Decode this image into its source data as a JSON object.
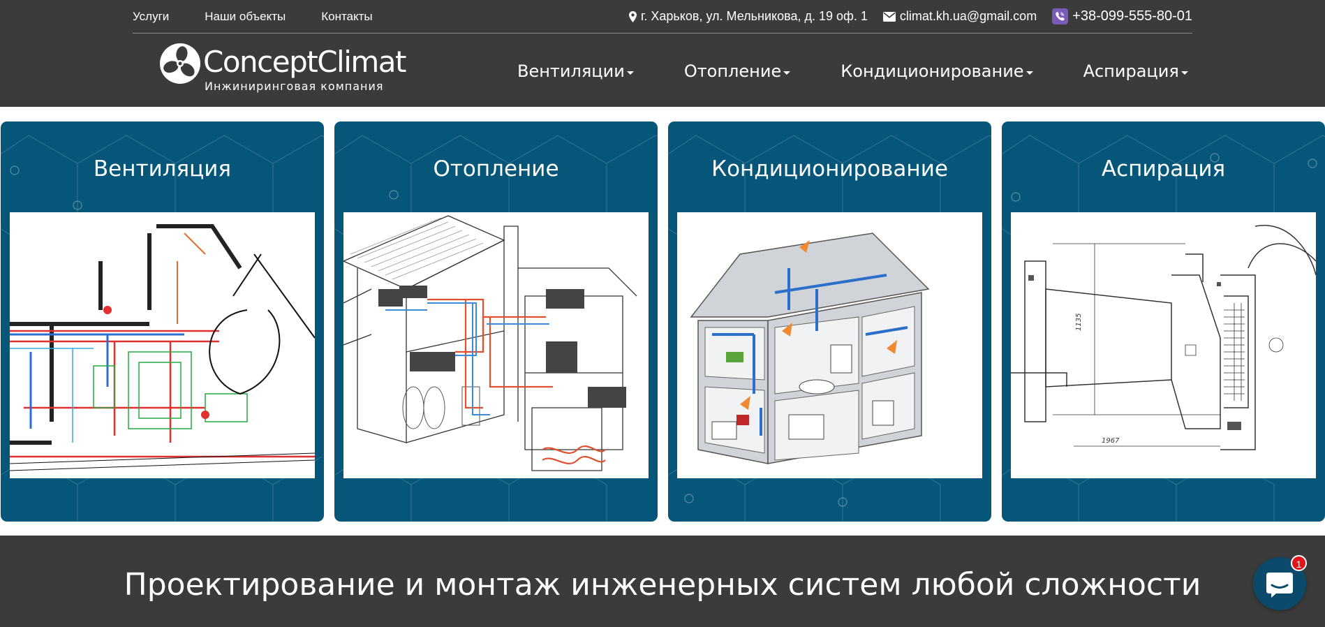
{
  "topbar": {
    "links": [
      "Услуги",
      "Наши объекты",
      "Контакты"
    ],
    "address": "г. Харьков, ул. Мельникова, д. 19 оф. 1",
    "email": "climat.kh.ua@gmail.com",
    "phone": "+38-099-555-80-01"
  },
  "logo": {
    "name": "ConceptClimat",
    "subtitle": "Инжиниринговая компания"
  },
  "nav": [
    "Вентиляции",
    "Отопление",
    "Кондиционирование",
    "Аспирация"
  ],
  "cards": [
    {
      "title": "Вентиляция"
    },
    {
      "title": "Отопление"
    },
    {
      "title": "Кондиционирование"
    },
    {
      "title": "Аспирация"
    }
  ],
  "tagline": "Проектирование и монтаж инженерных систем любой сложности",
  "chat": {
    "badge": "1"
  },
  "colors": {
    "header": "#3b3b3b",
    "card": "#06567a",
    "badge": "#e0141b",
    "phone_icon": "#7b5ab8"
  }
}
